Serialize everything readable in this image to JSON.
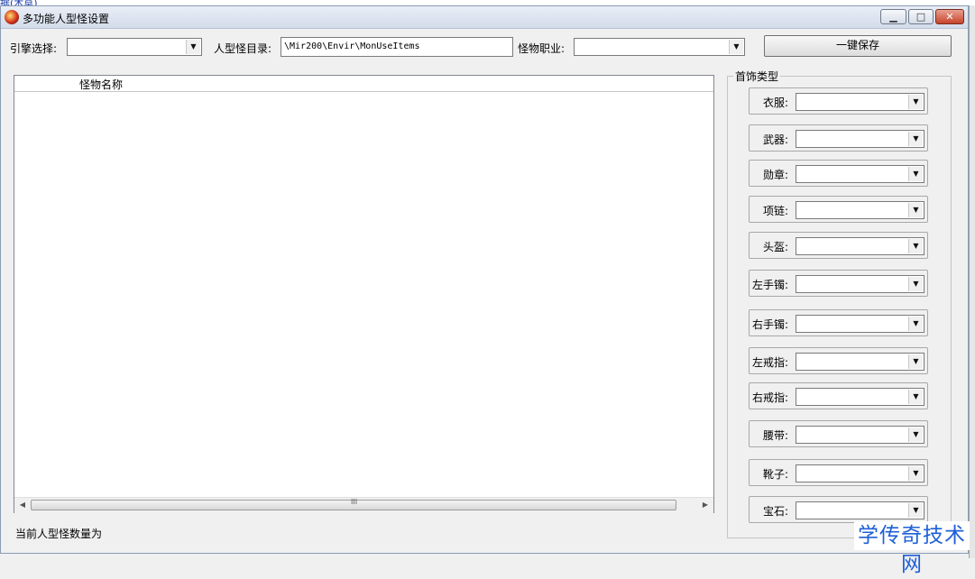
{
  "window": {
    "title": "多功能人型怪设置"
  },
  "toolbar": {
    "engine_label": "引擎选择:",
    "engine_value": "",
    "dir_label": "人型怪目录:",
    "dir_value": "\\Mir200\\Envir\\MonUseItems",
    "job_label": "怪物职业:",
    "job_value": "",
    "save_label": "一键保存"
  },
  "list": {
    "columns": [
      "怪物名称"
    ],
    "rows": [],
    "scroll_grip": "III"
  },
  "status": {
    "text": "当前人型怪数量为"
  },
  "equipment": {
    "title": "首饰类型",
    "slots": [
      {
        "label": "衣服:",
        "value": ""
      },
      {
        "label": "武器:",
        "value": ""
      },
      {
        "label": "勋章:",
        "value": ""
      },
      {
        "label": "项链:",
        "value": ""
      },
      {
        "label": "头盔:",
        "value": ""
      },
      {
        "label": "左手镯:",
        "value": ""
      },
      {
        "label": "右手镯:",
        "value": ""
      },
      {
        "label": "左戒指:",
        "value": ""
      },
      {
        "label": "右戒指:",
        "value": ""
      },
      {
        "label": "腰带:",
        "value": ""
      },
      {
        "label": "靴子:",
        "value": ""
      },
      {
        "label": "宝石:",
        "value": ""
      }
    ]
  },
  "background_window": {
    "fragment_text": "据(木草)"
  },
  "watermark": {
    "text": "学传奇技术网"
  },
  "icons": {
    "app": "game-app-icon",
    "minimize": "minimize-icon",
    "maximize": "maximize-icon",
    "close": "close-icon",
    "dropdown": "dropdown-arrow-icon",
    "scroll_left": "scroll-left-icon",
    "scroll_right": "scroll-right-icon"
  }
}
